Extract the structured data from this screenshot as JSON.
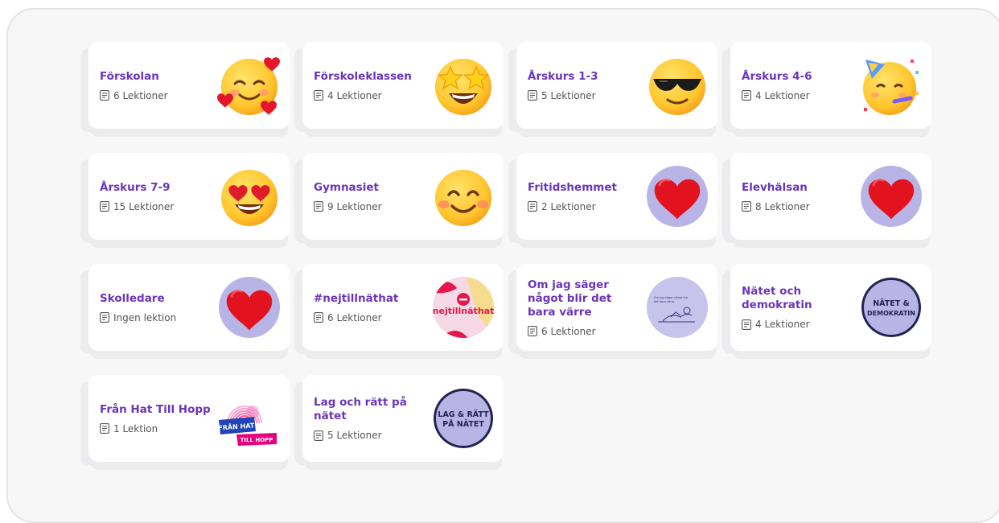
{
  "courses": [
    {
      "title": "Förskolan",
      "lessons": "6 Lektioner",
      "icon": "smiling-face-with-hearts-icon"
    },
    {
      "title": "Förskoleklassen",
      "lessons": "4 Lektioner",
      "icon": "star-struck-face-icon"
    },
    {
      "title": "Årskurs 1-3",
      "lessons": "5 Lektioner",
      "icon": "sunglasses-face-icon"
    },
    {
      "title": "Årskurs 4-6",
      "lessons": "4 Lektioner",
      "icon": "partying-face-icon"
    },
    {
      "title": "Årskurs 7-9",
      "lessons": "15 Lektioner",
      "icon": "heart-eyes-face-icon"
    },
    {
      "title": "Gymnasiet",
      "lessons": "9 Lektioner",
      "icon": "smiling-face-icon"
    },
    {
      "title": "Fritidshemmet",
      "lessons": "2 Lektioner",
      "icon": "heart-icon"
    },
    {
      "title": "Elevhälsan",
      "lessons": "8 Lektioner",
      "icon": "heart-icon"
    },
    {
      "title": "Skolledare",
      "lessons": "Ingen lektion",
      "icon": "heart-icon"
    },
    {
      "title": "#nejtillnäthat",
      "lessons": "6 Lektioner",
      "icon": "nejtillnathat-logo-icon",
      "logo_text": "nejtillnäthat"
    },
    {
      "title": "Om jag säger något blir det bara värre",
      "lessons": "6 Lektioner",
      "icon": "illustration-person-lying-icon",
      "logo_text": "Om jag säger något blir det bara värre"
    },
    {
      "title": "Nätet och demokratin",
      "lessons": "4 Lektioner",
      "icon": "natet-demokratin-badge-icon",
      "logo_text": "NÄTET & DEMOKRATIN"
    },
    {
      "title": "Från Hat Till Hopp",
      "lessons": "1 Lektion",
      "icon": "fran-hat-till-hopp-logo-icon",
      "logo_text": "FRÅN HAT TILL HOPP"
    },
    {
      "title": "Lag och rätt på nätet",
      "lessons": "5 Lektioner",
      "icon": "lag-ratt-natet-badge-icon",
      "logo_text": "LAG & RÄTT PÅ NÄTET"
    }
  ],
  "colors": {
    "title": "#6a35b8",
    "accent_circle": "#b8b5e6",
    "badge_navy": "#22254f",
    "pink": "#e6007e"
  }
}
